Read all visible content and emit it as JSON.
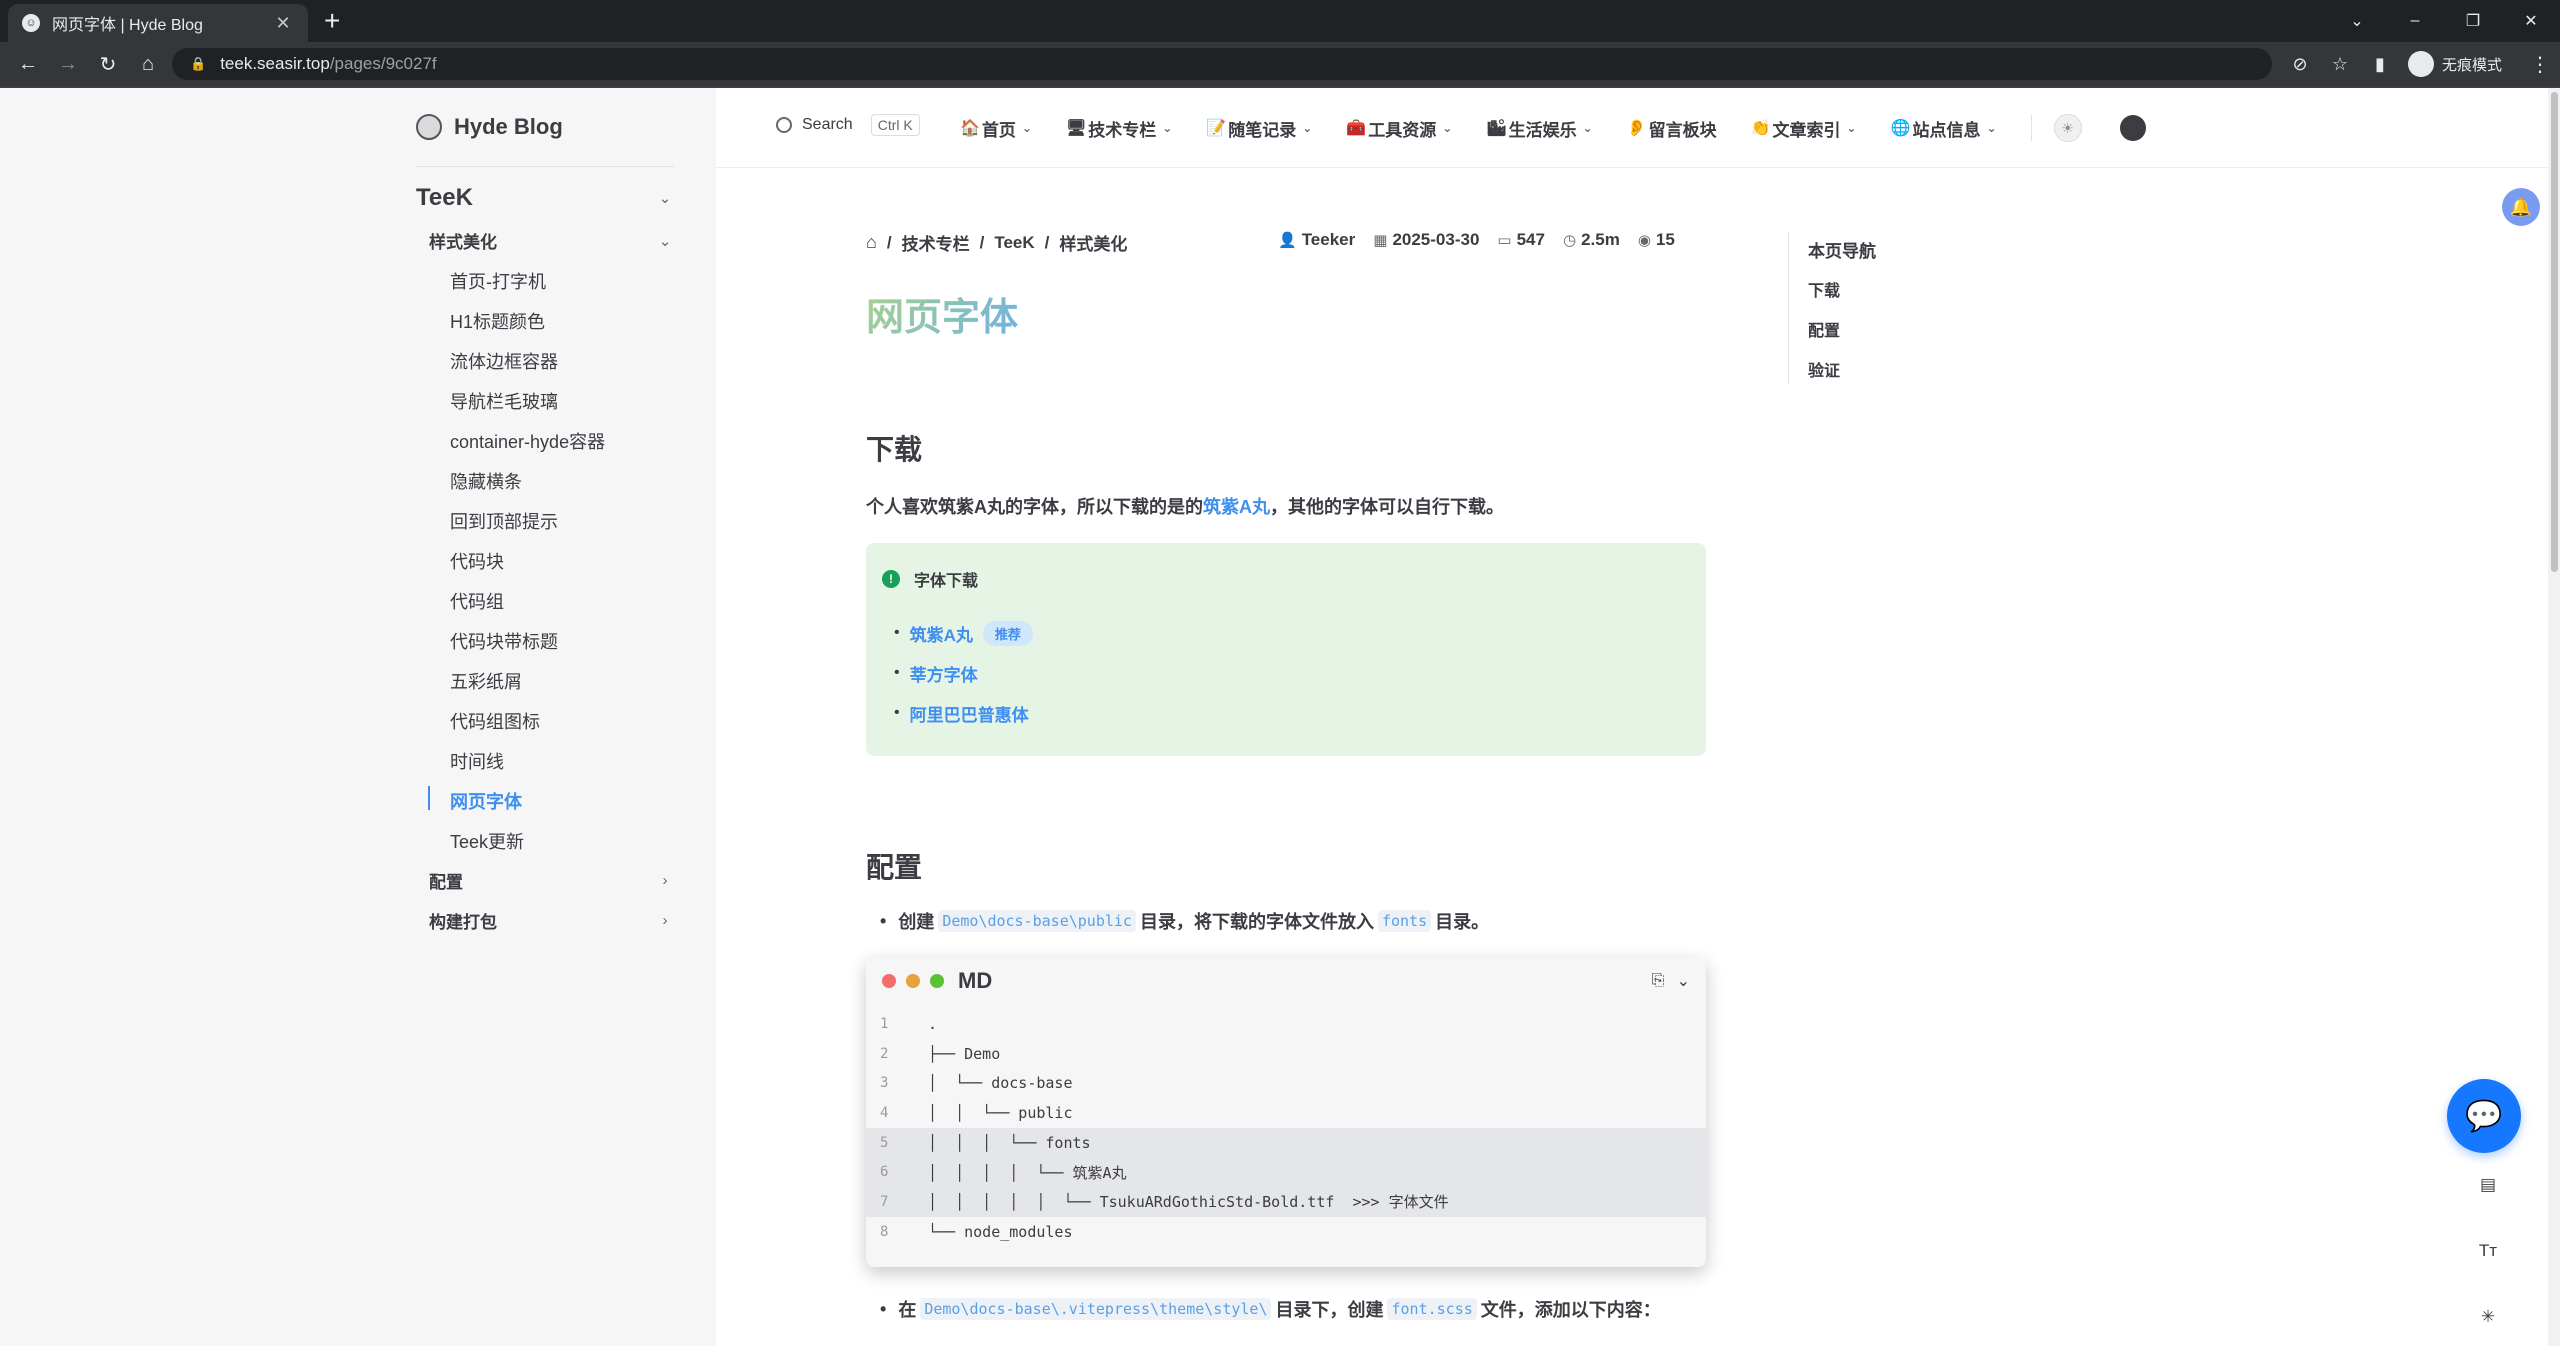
{
  "browser": {
    "tab_title": "网页字体 | Hyde Blog",
    "url_host": "teek.seasir.top",
    "url_path": "/pages/9c027f",
    "incognito_label": "无痕模式"
  },
  "sidebar": {
    "brand": "Hyde Blog",
    "section": "TeeK",
    "group_open": "样式美化",
    "items": [
      "首页-打字机",
      "H1标题颜色",
      "流体边框容器",
      "导航栏毛玻璃",
      "container-hyde容器",
      "隐藏横条",
      "回到顶部提示",
      "代码块",
      "代码组",
      "代码块带标题",
      "五彩纸屑",
      "代码组图标",
      "时间线",
      "网页字体",
      "Teek更新"
    ],
    "active_item": "网页字体",
    "groups_closed": [
      "配置",
      "构建打包"
    ]
  },
  "topnav": {
    "search_label": "Search",
    "search_kbd": "Ctrl K",
    "items": [
      {
        "icon": "🏠",
        "label": "首页"
      },
      {
        "icon": "🖥",
        "label": "技术专栏"
      },
      {
        "icon": "📝",
        "label": "随笔记录"
      },
      {
        "icon": "🧰",
        "label": "工具资源"
      },
      {
        "icon": "🏙",
        "label": "生活娱乐"
      },
      {
        "icon": "👂",
        "label": "留言板块"
      },
      {
        "icon": "👏",
        "label": "文章索引"
      },
      {
        "icon": "🌐",
        "label": "站点信息"
      }
    ]
  },
  "breadcrumb": [
    "技术专栏",
    "TeeK",
    "样式美化"
  ],
  "meta": {
    "author": "Teeker",
    "date": "2025-03-30",
    "words": "547",
    "read_time": "2.5m",
    "views": "15"
  },
  "article": {
    "title": "网页字体",
    "h2_download": "下载",
    "download_text_pre": "个人喜欢筑紫A丸的字体，所以下载的是的",
    "download_link": "筑紫A丸",
    "download_text_post": "，其他的字体可以自行下载。",
    "tip_title": "字体下载",
    "tip_links": [
      "筑紫A丸",
      "莘方字体",
      "阿里巴巴普惠体"
    ],
    "tip_badge": "推荐",
    "h2_config": "配置",
    "bullet1_pre": "创建",
    "bullet1_code1": "Demo\\docs-base\\public",
    "bullet1_mid": "目录，将下载的字体文件放入",
    "bullet1_code2": "fonts",
    "bullet1_post": "目录。",
    "code_lang": "MD",
    "code_lines": [
      ".",
      "├── Demo",
      "│  └── docs-base",
      "│  │  └── public",
      "│  │  │  └── fonts",
      "│  │  │  │  └── 筑紫A丸",
      "│  │  │  │  │  └── TsukuARdGothicStd-Bold.ttf  >>> 字体文件",
      "└── node_modules"
    ],
    "bullet2_pre": "在",
    "bullet2_code1": "Demo\\docs-base\\.vitepress\\theme\\style\\",
    "bullet2_mid": "目录下，创建",
    "bullet2_code2": "font.scss",
    "bullet2_post": "文件，添加以下内容："
  },
  "toc": {
    "title": "本页导航",
    "items": [
      "下载",
      "配置",
      "验证"
    ]
  }
}
